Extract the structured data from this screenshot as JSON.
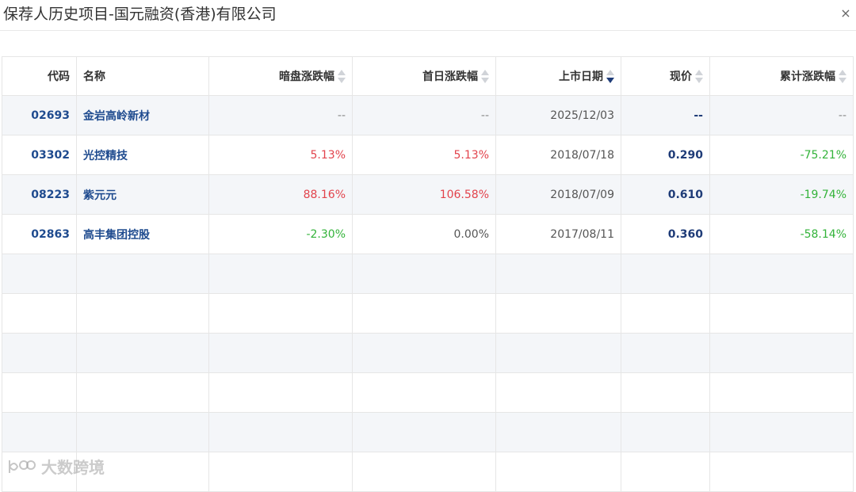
{
  "dialog": {
    "title": "保荐人历史项目-国元融资(香港)有限公司",
    "close_label": "×"
  },
  "table": {
    "headers": {
      "code": "代码",
      "name": "名称",
      "grey": "暗盘涨跌幅",
      "first_day": "首日涨跌幅",
      "list_date": "上市日期",
      "price": "现价",
      "cumulative": "累计涨跌幅"
    },
    "rows": [
      {
        "code": "02693",
        "name": "金岩高岭新材",
        "grey": "--",
        "first_day": "--",
        "list_date": "2025/12/03",
        "price": "--",
        "cumulative": "--"
      },
      {
        "code": "03302",
        "name": "光控精技",
        "grey": "5.13%",
        "first_day": "5.13%",
        "list_date": "2018/07/18",
        "price": "0.290",
        "cumulative": "-75.21%"
      },
      {
        "code": "08223",
        "name": "紫元元",
        "grey": "88.16%",
        "first_day": "106.58%",
        "list_date": "2018/07/09",
        "price": "0.610",
        "cumulative": "-19.74%"
      },
      {
        "code": "02863",
        "name": "高丰集团控股",
        "grey": "-2.30%",
        "first_day": "0.00%",
        "list_date": "2017/08/11",
        "price": "0.360",
        "cumulative": "-58.14%"
      }
    ],
    "sort": {
      "column": "list_date",
      "direction": "desc"
    }
  },
  "colors": {
    "up": "#e2434c",
    "down": "#33b33a",
    "link": "#1f4b8f",
    "stripe": "#f4f6f9"
  },
  "icons": {
    "close": "close-icon",
    "sort": "sort-caret-icon",
    "watermark": "watermark-logo-icon"
  },
  "watermark": {
    "text": "大数跨境"
  }
}
